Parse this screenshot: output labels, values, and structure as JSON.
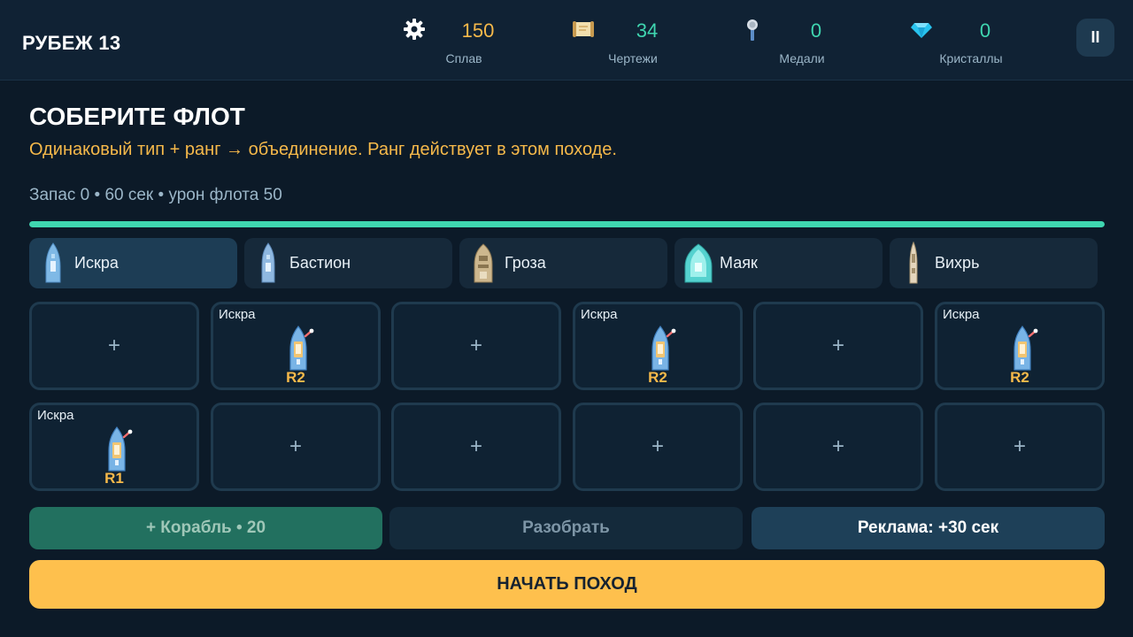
{
  "header": {
    "level_title": "РУБЕЖ 13",
    "resources": [
      {
        "icon": "gear-icon",
        "value": "150",
        "label": "Сплав",
        "color": "#f6b94a"
      },
      {
        "icon": "scroll-icon",
        "value": "34",
        "label": "Чертежи",
        "color": "#3fd6b0"
      },
      {
        "icon": "medal-icon",
        "value": "0",
        "label": "Медали",
        "color": "#3fd6b0"
      },
      {
        "icon": "diamond-icon",
        "value": "0",
        "label": "Кристаллы",
        "color": "#3fd6b0"
      }
    ],
    "pause_icon": "pause-icon",
    "pause_label": "II"
  },
  "main": {
    "title": "СОБЕРИТЕ ФЛОТ",
    "hint": "Одинаковый тип + ранг → объединение. Ранг действует в этом походе.",
    "stats": "Запас 0 • 60 сек • урон флота 50",
    "progress": 1.0
  },
  "ship_tabs": [
    {
      "label": "Искра",
      "icon": "ship-iskra-icon",
      "active": true
    },
    {
      "label": "Бастион",
      "icon": "ship-bastion-icon",
      "active": false
    },
    {
      "label": "Гроза",
      "icon": "ship-groza-icon",
      "active": false
    },
    {
      "label": "Маяк",
      "icon": "ship-mayak-icon",
      "active": false
    },
    {
      "label": "Вихрь",
      "icon": "ship-vikhr-icon",
      "active": false
    }
  ],
  "grid": {
    "empty_label": "+",
    "slots": [
      {
        "ship": null,
        "rank": null
      },
      {
        "ship": "Искра",
        "rank": "R2"
      },
      {
        "ship": null,
        "rank": null
      },
      {
        "ship": "Искра",
        "rank": "R2"
      },
      {
        "ship": null,
        "rank": null
      },
      {
        "ship": "Искра",
        "rank": "R2"
      },
      {
        "ship": "Искра",
        "rank": "R1"
      },
      {
        "ship": null,
        "rank": null
      },
      {
        "ship": null,
        "rank": null
      },
      {
        "ship": null,
        "rank": null
      },
      {
        "ship": null,
        "rank": null
      },
      {
        "ship": null,
        "rank": null
      }
    ]
  },
  "actions": {
    "add_ship": "+ Корабль • 20",
    "scrap": "Разобрать",
    "ad": "Реклама: +30 сек",
    "start": "НАЧАТЬ ПОХОД"
  }
}
